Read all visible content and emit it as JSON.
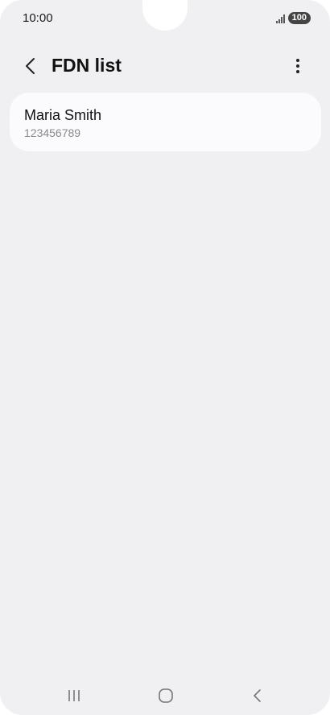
{
  "status_bar": {
    "time": "10:00",
    "battery": "100",
    "icons": [
      "signal-icon",
      "battery-icon"
    ]
  },
  "header": {
    "title": "FDN list",
    "back_icon": "chevron-left-icon",
    "menu_icon": "more-vertical-icon"
  },
  "fdn_list": [
    {
      "name": "Maria Smith",
      "number": "123456789"
    }
  ],
  "nav_bar": {
    "icons": [
      "recent-apps-icon",
      "home-icon",
      "back-icon"
    ]
  },
  "colors": {
    "background": "#f0f0f2",
    "card": "#fbfbfd",
    "text_primary": "#111111",
    "text_secondary": "#8a8a8a"
  }
}
